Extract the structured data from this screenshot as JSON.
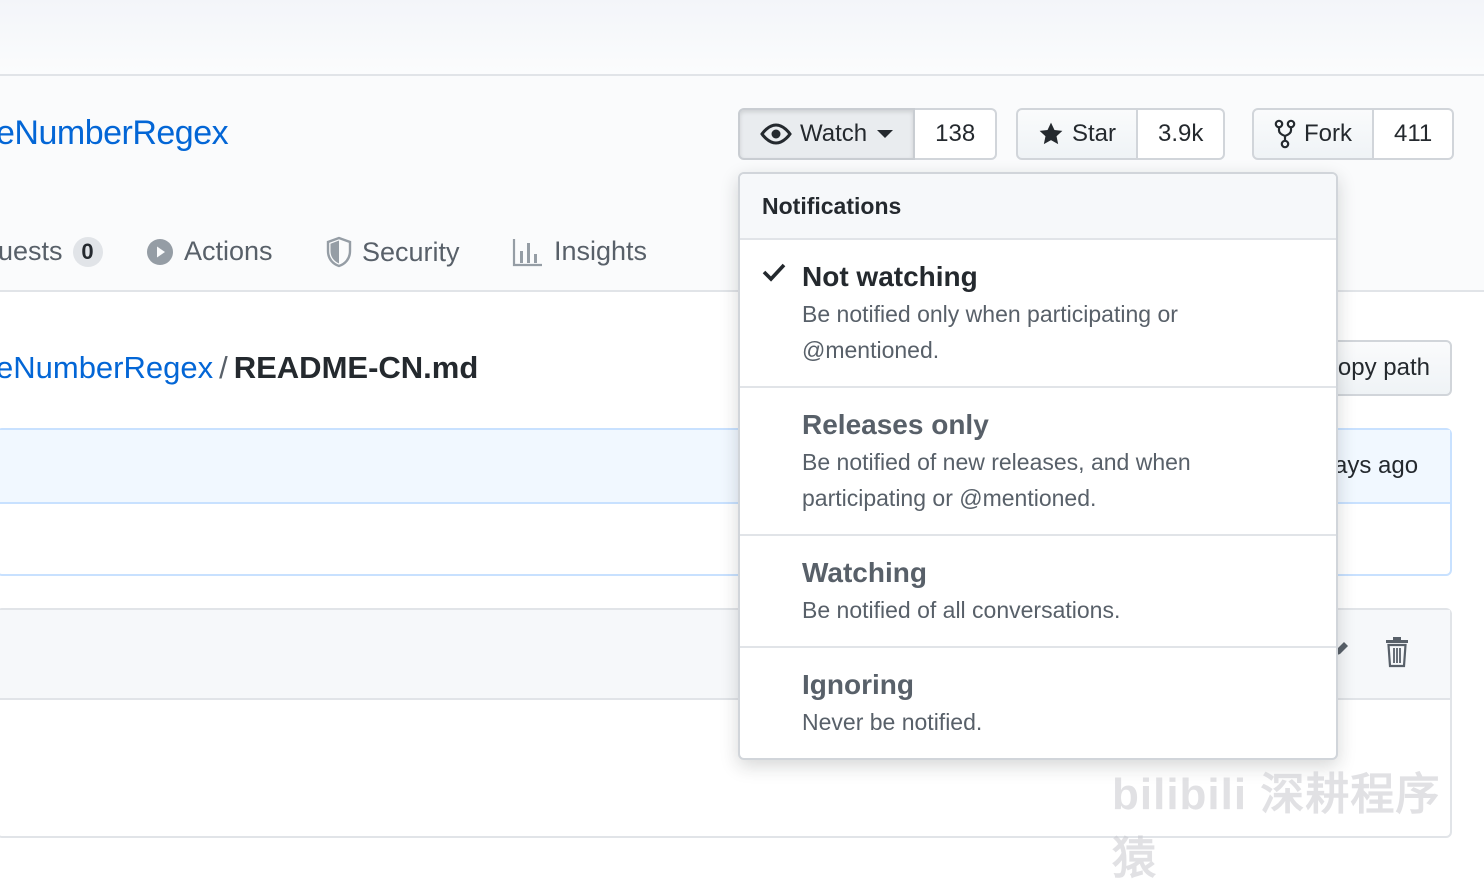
{
  "repo": {
    "title_partial": "eNumberRegex",
    "watch": {
      "label": "Watch",
      "count": "138"
    },
    "star": {
      "label": "Star",
      "count": "3.9k"
    },
    "fork": {
      "label": "Fork",
      "count": "411"
    }
  },
  "tabs": {
    "pull_requests": {
      "label": "uests",
      "count": "0"
    },
    "actions": {
      "label": "Actions"
    },
    "security": {
      "label": "Security"
    },
    "insights": {
      "label": "Insights"
    }
  },
  "breadcrumb": {
    "repo": "eNumberRegex",
    "separator": "/",
    "file": "README-CN.md"
  },
  "copy_path_label": "opy path",
  "commit_time": "ays ago",
  "dropdown": {
    "header": "Notifications",
    "items": [
      {
        "title": "Not watching",
        "desc": "Be notified only when participating or @mentioned.",
        "selected": true
      },
      {
        "title": "Releases only",
        "desc": "Be notified of new releases, and when participating or @mentioned.",
        "selected": false
      },
      {
        "title": "Watching",
        "desc": "Be notified of all conversations.",
        "selected": false
      },
      {
        "title": "Ignoring",
        "desc": "Never be notified.",
        "selected": false
      }
    ]
  },
  "watermark": "bilibili 深耕程序猿"
}
